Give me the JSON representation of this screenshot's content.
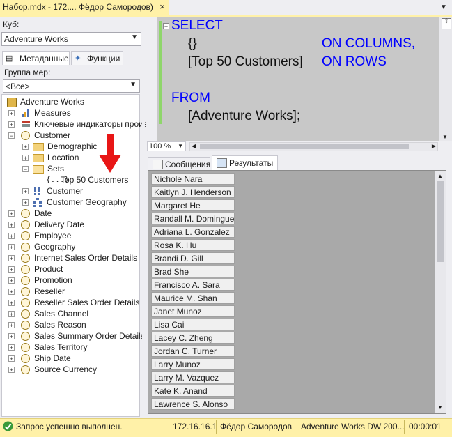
{
  "doc_tab": {
    "title": "Набор.mdx - 172.... Фёдор Самородов)",
    "close": "×",
    "dropdown": "▼"
  },
  "left": {
    "cube_label": "Куб:",
    "cube_value": "Adventure Works",
    "tabs": [
      {
        "label": "Метаданные"
      },
      {
        "label": "Функции"
      }
    ],
    "group_label": "Группа мер:",
    "group_value": "<Все>",
    "tree": {
      "root": "Adventure Works",
      "items": [
        {
          "label": "Measures"
        },
        {
          "label": "Ключевые индикаторы произ"
        },
        {
          "label": "Customer"
        },
        {
          "label": "Demographic"
        },
        {
          "label": "Location"
        },
        {
          "label": "Sets"
        },
        {
          "label": "Top 50 Customers"
        },
        {
          "label": "Customer"
        },
        {
          "label": "Customer Geography"
        },
        {
          "label": "Date"
        },
        {
          "label": "Delivery Date"
        },
        {
          "label": "Employee"
        },
        {
          "label": "Geography"
        },
        {
          "label": "Internet Sales Order Details"
        },
        {
          "label": "Product"
        },
        {
          "label": "Promotion"
        },
        {
          "label": "Reseller"
        },
        {
          "label": "Reseller Sales Order Details"
        },
        {
          "label": "Sales Channel"
        },
        {
          "label": "Sales Reason"
        },
        {
          "label": "Sales Summary Order Details"
        },
        {
          "label": "Sales Territory"
        },
        {
          "label": "Ship Date"
        },
        {
          "label": "Source Currency"
        }
      ],
      "set_glyph": "{...}",
      "collapse_glyph": "−",
      "expand_glyph": "+"
    }
  },
  "editor": {
    "lines": [
      "SELECT",
      "{}",
      "ON COLUMNS,",
      "[Top 50 Customers]",
      "ON ROWS",
      "FROM",
      "[Adventure Works];"
    ],
    "collapse_glyph": "−",
    "zoom": "100 %"
  },
  "results": {
    "tabs": [
      {
        "label": "Сообщения"
      },
      {
        "label": "Результаты"
      }
    ],
    "rows": [
      "Nichole Nara",
      "Kaitlyn J. Henderson",
      "Margaret He",
      "Randall M. Dominguez",
      "Adriana L. Gonzalez",
      "Rosa K. Hu",
      "Brandi D. Gill",
      "Brad She",
      "Francisco A. Sara",
      "Maurice M. Shan",
      "Janet Munoz",
      "Lisa Cai",
      "Lacey C. Zheng",
      "Jordan C. Turner",
      "Larry Munoz",
      "Larry M. Vazquez",
      "Kate K. Anand",
      "Lawrence S. Alonso"
    ]
  },
  "status": {
    "message": "Запрос успешно выполнен.",
    "server": "172.16.16.1",
    "user": "Фёдор Самородов",
    "database": "Adventure Works DW 200...",
    "elapsed": "00:00:01"
  },
  "colors": {
    "accent": "#fff1a8",
    "keyword": "#0000ff",
    "arrow": "#e81616",
    "success": "#3a9a3a"
  }
}
